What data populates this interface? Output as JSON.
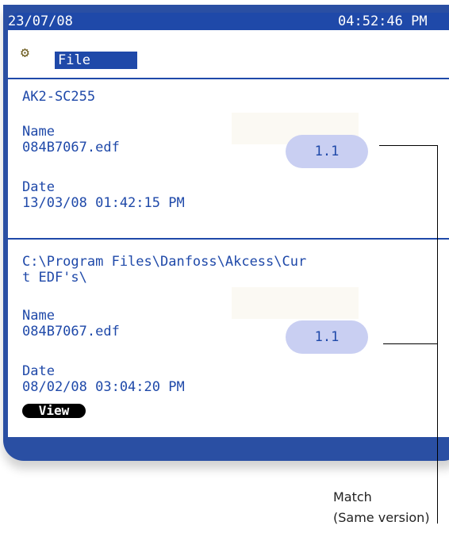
{
  "status_bar": {
    "date": "23/07/08",
    "time": "04:52:46 PM"
  },
  "menu": {
    "icon": "settings-gear-icon",
    "file_label": "File"
  },
  "controller_section": {
    "device": "AK2-SC255",
    "name_label": "Name",
    "name_value": "084B7067.edf",
    "version": "1.1",
    "date_label": "Date",
    "date_value": "13/03/08 01:42:15 PM"
  },
  "pc_section": {
    "path_line1": "C:\\Program Files\\Danfoss\\Akcess\\Cur",
    "path_line2": "t EDF's\\",
    "name_label": "Name",
    "name_value": "084B7067.edf",
    "version": "1.1",
    "date_label": "Date",
    "date_value": "08/02/08 03:04:20 PM",
    "view_button": "View"
  },
  "annotation": {
    "line1": "Match",
    "line2": "(Same version)"
  },
  "colors": {
    "accent": "#1f49a9",
    "pill": "#c9cff2",
    "frame": "#2a4fa3"
  }
}
